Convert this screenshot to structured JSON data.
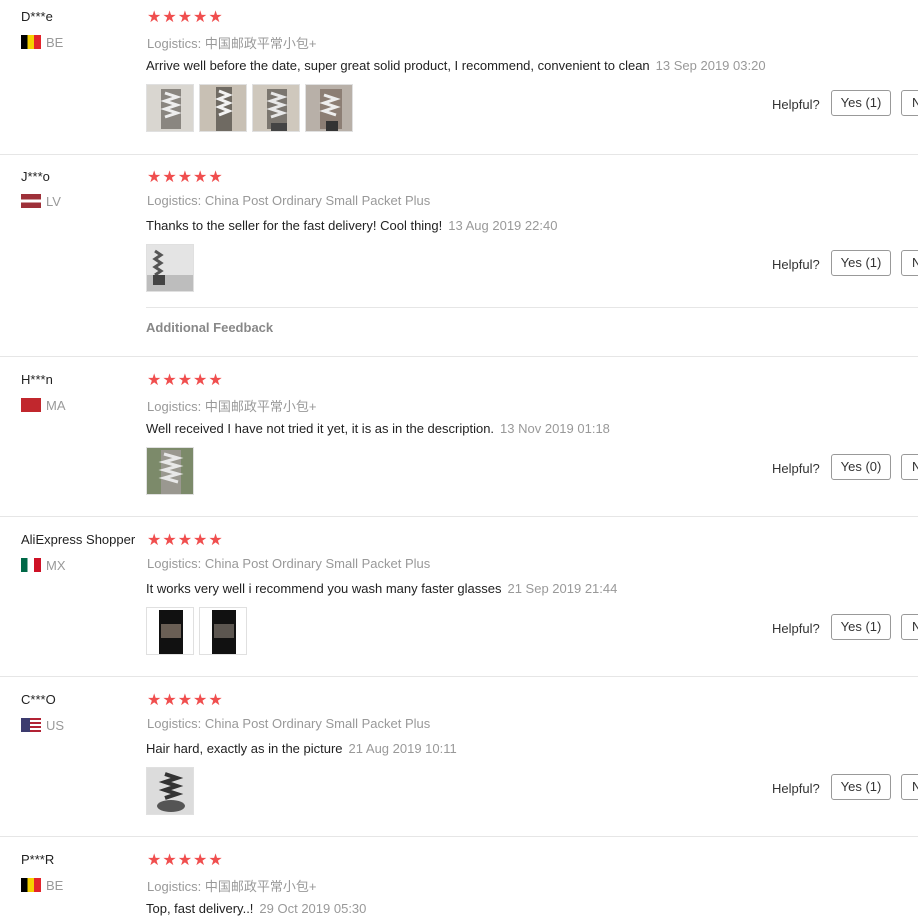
{
  "labels": {
    "logistics": "Logistics:",
    "helpful": "Helpful?",
    "no_button": "N",
    "additional_feedback": "Additional Feedback"
  },
  "colors": {
    "star": "#f04e4e",
    "muted": "#999999",
    "text": "#222222"
  },
  "reviews": [
    {
      "user": "D***e",
      "country": "BE",
      "flag": "belgium-flag-icon",
      "stars": 5,
      "logistics": "中国邮政平常小包+",
      "text": "Arrive well before the date, super great solid product, I recommend, convenient to clean",
      "date": "13 Sep 2019 03:20",
      "yes": "Yes (1)",
      "photos": [
        "review-photo",
        "review-photo",
        "review-photo",
        "review-photo"
      ]
    },
    {
      "user": "J***o",
      "country": "LV",
      "flag": "latvia-flag-icon",
      "stars": 5,
      "logistics": "China Post Ordinary Small Packet Plus",
      "text": "Thanks to the seller for the fast delivery! Cool thing!",
      "date": "13 Aug 2019 22:40",
      "yes": "Yes (1)",
      "photos": [
        "review-photo"
      ]
    },
    {
      "user": "H***n",
      "country": "MA",
      "flag": "morocco-flag-icon",
      "stars": 5,
      "logistics": "中国邮政平常小包+",
      "text": "Well received I have not tried it yet, it is as in the description.",
      "date": "13 Nov 2019 01:18",
      "yes": "Yes (0)",
      "photos": [
        "review-photo"
      ]
    },
    {
      "user": "AliExpress Shopper",
      "country": "MX",
      "flag": "mexico-flag-icon",
      "stars": 5,
      "logistics": "China Post Ordinary Small Packet Plus",
      "text": "It works very well i recommend you wash many faster glasses",
      "date": "21 Sep 2019 21:44",
      "yes": "Yes (1)",
      "photos": [
        "review-photo",
        "review-photo"
      ]
    },
    {
      "user": "C***O",
      "country": "US",
      "flag": "usa-flag-icon",
      "stars": 5,
      "logistics": "China Post Ordinary Small Packet Plus",
      "text": "Hair hard, exactly as in the picture",
      "date": "21 Aug 2019 10:11",
      "yes": "Yes (1)",
      "photos": [
        "review-photo"
      ]
    },
    {
      "user": "P***R",
      "country": "BE",
      "flag": "belgium-flag-icon",
      "stars": 5,
      "logistics": "中国邮政平常小包+",
      "text": "Top, fast delivery..!",
      "date": "29 Oct 2019 05:30"
    }
  ]
}
